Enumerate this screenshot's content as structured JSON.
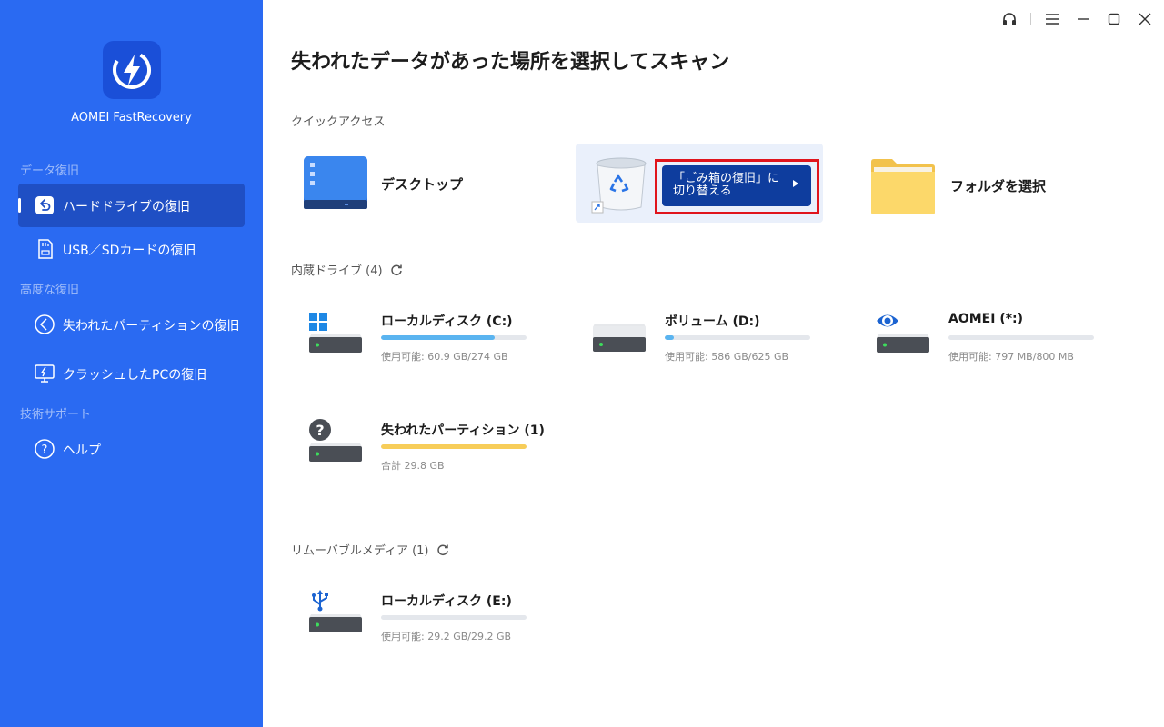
{
  "sidebar": {
    "app_name": "AOMEI FastRecovery",
    "sections": {
      "data_recovery": "データ復旧",
      "advanced": "高度な復旧",
      "support": "技術サポート"
    },
    "items": {
      "hdd": "ハードドライブの復旧",
      "usb": "USB／SDカードの復旧",
      "partition": "失われたパーティションの復旧",
      "crash": "クラッシュしたPCの復旧",
      "help": "ヘルプ"
    }
  },
  "main": {
    "title": "失われたデータがあった場所を選択してスキャン",
    "quick_access": {
      "label": "クイックアクセス",
      "desktop": "デスクトップ",
      "recycle_switch": "「ごみ箱の復旧」に切り替える",
      "folder": "フォルダを選択"
    },
    "internal": {
      "label": "内蔵ドライブ (4)",
      "drives": [
        {
          "name": "ローカルディスク (C:)",
          "caption": "使用可能: 60.9 GB/274 GB",
          "used_fraction": 0.78,
          "color": "#5ab4f0"
        },
        {
          "name": "ボリューム (D:)",
          "caption": "使用可能: 586 GB/625 GB",
          "used_fraction": 0.06,
          "color": "#5ab4f0"
        },
        {
          "name": "AOMEI (*:)",
          "caption": "使用可能: 797 MB/800 MB",
          "used_fraction": 0.0,
          "color": "#5ab4f0"
        },
        {
          "name": "失われたパーティション (1)",
          "caption": "合計 29.8 GB",
          "used_fraction": 1.0,
          "color": "#f7cd59"
        }
      ]
    },
    "removable": {
      "label": "リムーバブルメディア (1)",
      "drives": [
        {
          "name": "ローカルディスク (E:)",
          "caption": "使用可能: 29.2 GB/29.2 GB",
          "used_fraction": 0.0,
          "color": "#5ab4f0"
        }
      ]
    }
  },
  "icons": {
    "headset": "headset-icon",
    "menu": "menu-icon",
    "minimize": "minimize-icon",
    "maximize": "maximize-icon",
    "close": "close-icon",
    "refresh": "refresh-icon"
  },
  "colors": {
    "sidebar": "#2a6af2",
    "active_nav": "#1f4fc4",
    "switch_button": "#0e3d9e",
    "highlight_outline": "#e0141c"
  }
}
